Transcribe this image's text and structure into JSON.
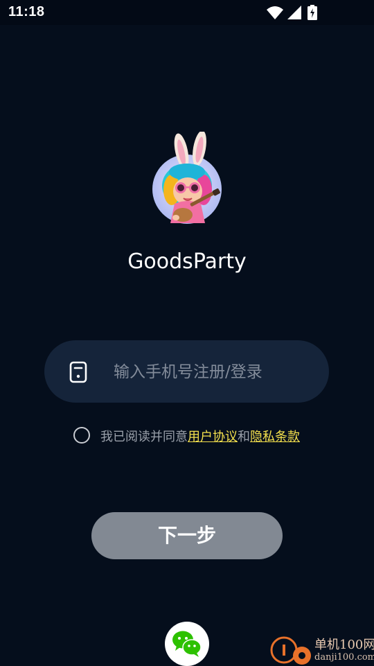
{
  "status_bar": {
    "time": "11:18",
    "icons": [
      "wifi-icon",
      "signal-icon",
      "battery-charging-icon"
    ]
  },
  "app": {
    "name": "GoodsParty",
    "avatar": "bunny-girl-ukulele-avatar"
  },
  "login": {
    "phone_placeholder": "输入手机号注册/登录",
    "phone_value": "",
    "phone_icon": "phone-icon",
    "agreement": {
      "checked": false,
      "prefix": "我已阅读并同意",
      "user_agreement": "用户协议",
      "conjunction": "和",
      "privacy_policy": "隐私条款"
    },
    "next_button": "下一步",
    "alt_login_icon": "wechat-icon"
  },
  "watermark": {
    "title": "单机100网",
    "url": "danji100.com"
  },
  "colors": {
    "background": "#050e1c",
    "input_bg": "#15243a",
    "button_bg": "#828993",
    "link": "#f4e04d",
    "wechat_green": "#2dc100"
  }
}
